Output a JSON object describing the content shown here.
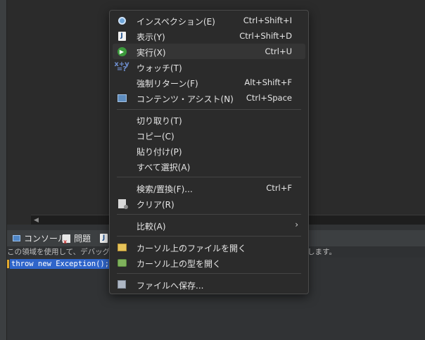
{
  "editor": {
    "console_tab_label": "コンソール",
    "problems_tab_label": "問題",
    "third_tab_glyph": "J",
    "console_hint_head": "この領域を使用して、デバッグ・",
    "console_hint_tail": "行します。",
    "selected_code": "throw new Exception();"
  },
  "context_menu": {
    "items": [
      {
        "label": "インスペクション(E)",
        "shortcut": "Ctrl+Shift+I",
        "icon": "magnifier-icon"
      },
      {
        "label": "表示(Y)",
        "shortcut": "Ctrl+Shift+D",
        "icon": "display-icon"
      },
      {
        "label": "実行(X)",
        "shortcut": "Ctrl+U",
        "icon": "execute-icon"
      },
      {
        "label": "ウォッチ(T)",
        "shortcut": "",
        "icon": "watch-icon"
      },
      {
        "label": "強制リターン(F)",
        "shortcut": "Alt+Shift+F",
        "icon": ""
      },
      {
        "label": "コンテンツ・アシスト(N)",
        "shortcut": "Ctrl+Space",
        "icon": "content-assist-icon"
      },
      {
        "label": "切り取り(T)",
        "shortcut": "",
        "icon": ""
      },
      {
        "label": "コピー(C)",
        "shortcut": "",
        "icon": ""
      },
      {
        "label": "貼り付け(P)",
        "shortcut": "",
        "icon": ""
      },
      {
        "label": "すべて選択(A)",
        "shortcut": "",
        "icon": ""
      },
      {
        "label": "検索/置換(F)...",
        "shortcut": "Ctrl+F",
        "icon": ""
      },
      {
        "label": "クリア(R)",
        "shortcut": "",
        "icon": "clear-icon"
      },
      {
        "label": "比較(A)",
        "shortcut": "",
        "icon": "",
        "submenu_arrow": "›"
      },
      {
        "label": "カーソル上のファイルを開く",
        "shortcut": "",
        "icon": "open-file-icon"
      },
      {
        "label": "カーソル上の型を開く",
        "shortcut": "",
        "icon": "open-type-icon"
      },
      {
        "label": "ファイルへ保存...",
        "shortcut": "",
        "icon": "save-icon"
      }
    ]
  },
  "glyphs": {
    "j_letter": "J",
    "run_arrow": "▶",
    "watch_top": "x+y",
    "watch_bottom": "=?",
    "scroll_left": "◀"
  },
  "colors": {
    "menu_bg": "#2b2b2b",
    "menu_highlight": "#353535",
    "selection": "#2f65ca",
    "editor_bg": "#2b2b2b"
  }
}
